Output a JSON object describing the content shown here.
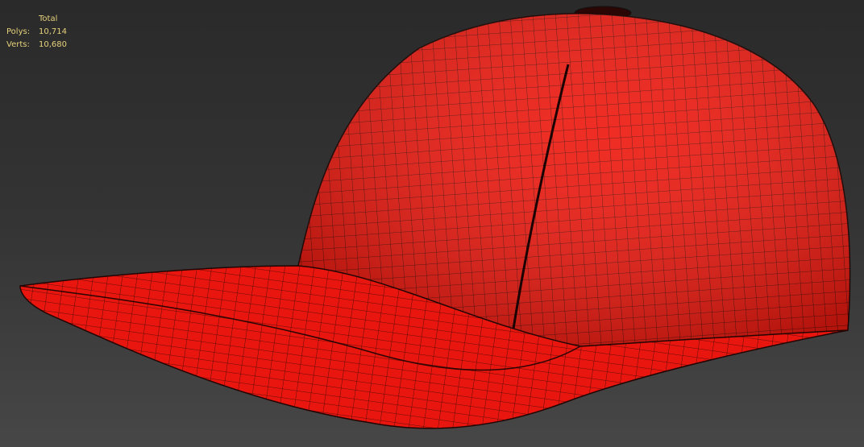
{
  "stats": {
    "header": "Total",
    "polys_label": "Polys:",
    "polys_value": "10,714",
    "verts_label": "Verts:",
    "verts_value": "10,680"
  },
  "model": {
    "name": "baseball-cap",
    "color": "#ee1a10",
    "wire_color": "#3a0a06"
  }
}
